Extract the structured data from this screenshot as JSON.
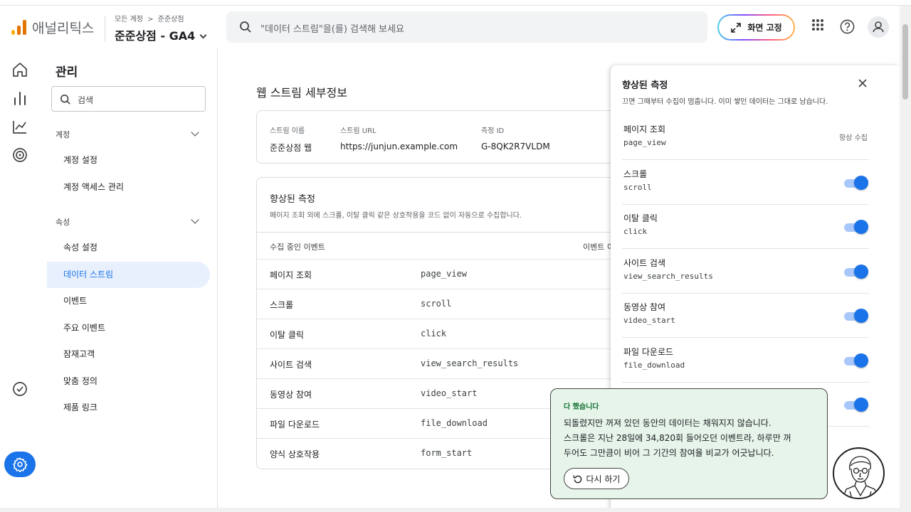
{
  "header": {
    "brand": "애널리틱스",
    "breadcrumb_root": "모든 계정",
    "breadcrumb_sep": ">",
    "breadcrumb_account": "준준상점",
    "property": "준준상점 - GA4",
    "search_placeholder": "\"데이터 스트림\"을(를) 검색해 보세요",
    "pin_button": "화면 고정",
    "icons": [
      "apps-grid-icon",
      "help-icon",
      "account-avatar-icon"
    ]
  },
  "nav": {
    "title": "관리",
    "search_placeholder": "검색",
    "account_section": "계정",
    "account_items": [
      "계정 설정",
      "계정 액세스 관리"
    ],
    "property_section": "속성",
    "property_items": [
      "속성 설정",
      "데이터 스트림",
      "이벤트",
      "주요 이벤트",
      "잠재고객",
      "맞춤 정의",
      "제품 링크"
    ],
    "active_item": "데이터 스트림"
  },
  "main": {
    "title": "웹 스트림 세부정보",
    "stream": {
      "name_label": "스트림 이름",
      "name": "준준상점 웹",
      "url_label": "스트림 URL",
      "url": "https://junjun.example.com",
      "id_label": "측정 ID",
      "id": "G-8QK2R7VLDM"
    },
    "enhanced": {
      "title": "향상된 측정",
      "desc": "페이지 조회 외에 스크롤, 이탈 클릭 같은 상호작용을 코드 없이 자동으로 수집합니다.",
      "col_events": "수집 중인 이벤트",
      "col_second": "이벤트 이",
      "rows": [
        {
          "label": "페이지 조회",
          "code": "page_view"
        },
        {
          "label": "스크롤",
          "code": "scroll"
        },
        {
          "label": "이탈 클릭",
          "code": "click"
        },
        {
          "label": "사이트 검색",
          "code": "view_search_results"
        },
        {
          "label": "동영상 참여",
          "code": "video_start"
        },
        {
          "label": "파일 다운로드",
          "code": "file_download"
        },
        {
          "label": "양식 상호작용",
          "code": "form_start"
        }
      ]
    }
  },
  "panel": {
    "title": "향상된 측정",
    "desc": "끄면 그때부터 수집이 멈춥니다. 이미 쌓인 데이터는 그대로 남습니다.",
    "always_label": "항상 수집",
    "rows": [
      {
        "label": "페이지 조회",
        "code": "page_view",
        "toggle": null
      },
      {
        "label": "스크롤",
        "code": "scroll",
        "toggle": true
      },
      {
        "label": "이탈 클릭",
        "code": "click",
        "toggle": true
      },
      {
        "label": "사이트 검색",
        "code": "view_search_results",
        "toggle": true
      },
      {
        "label": "동영상 참여",
        "code": "video_start",
        "toggle": true
      },
      {
        "label": "파일 다운로드",
        "code": "file_download",
        "toggle": true
      },
      {
        "label": "",
        "code": "",
        "toggle": true
      }
    ]
  },
  "toast": {
    "title": "다 했습니다",
    "line1": "되돌렸지만 꺼져 있던 동안의 데이터는 채워지지 않습니다.",
    "line2": "스크롤은 지난 28일에 34,820회 들어오던 이벤트라, 하루만 꺼",
    "line3": "두어도 그만큼이 비어 그 기간의 참여율 비교가 어긋납니다.",
    "undo": "다시 하기"
  },
  "colors": {
    "accent": "#1a73e8",
    "active_bg": "#e8f0fe",
    "toast_bg": "#e6f4ea",
    "toast_title": "#137333",
    "logo": [
      "#f9ab00",
      "#e37400",
      "#e37400"
    ]
  }
}
